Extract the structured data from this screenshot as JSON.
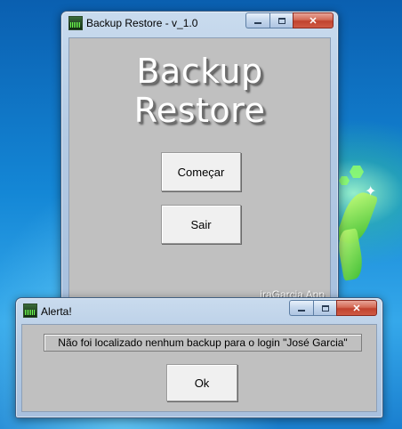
{
  "main_window": {
    "title": "Backup Restore - v_1.0",
    "heading": "Backup Restore",
    "start_button": "Começar",
    "exit_button": "Sair",
    "watermark": "jraGarcia App"
  },
  "alert_window": {
    "title": "Alerta!",
    "message": "Não foi localizado nenhum backup para o login \"José Garcia\"",
    "ok_button": "Ok"
  },
  "icons": {
    "app_icon": "equalizer-app-icon",
    "minimize": "minimize-icon",
    "maximize": "maximize-icon",
    "close": "close-icon"
  },
  "colors": {
    "client_background": "#c0c0c0",
    "close_button": "#c1432f",
    "heading_text": "#ffffff"
  }
}
